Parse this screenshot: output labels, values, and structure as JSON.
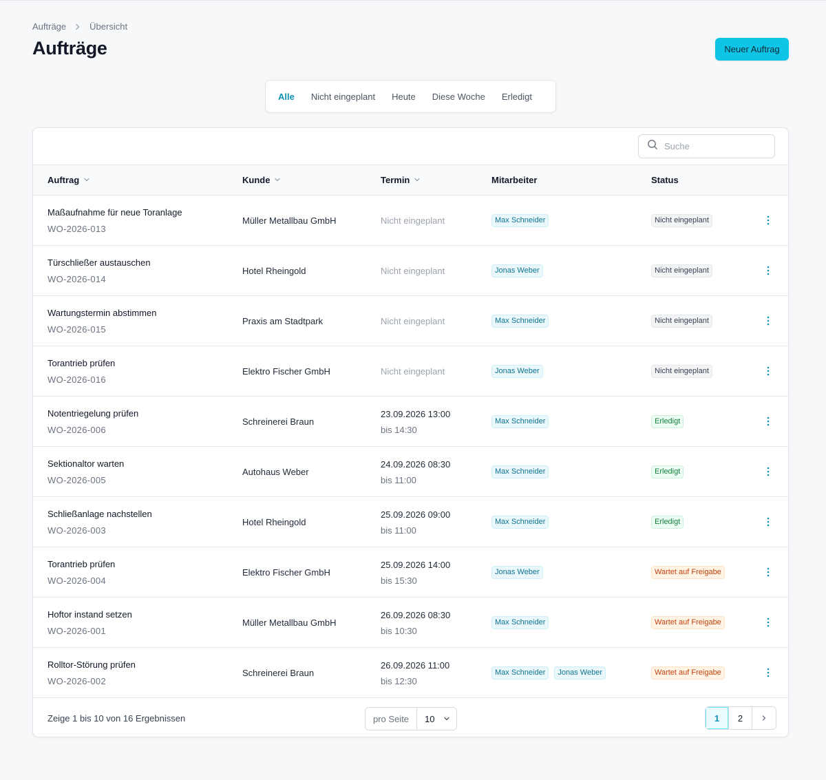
{
  "breadcrumb": {
    "parent": "Aufträge",
    "current": "Übersicht"
  },
  "page_title": "Aufträge",
  "new_order_label": "Neuer Auftrag",
  "tabs": [
    {
      "label": "Alle",
      "active": true
    },
    {
      "label": "Nicht eingeplant"
    },
    {
      "label": "Heute"
    },
    {
      "label": "Diese Woche"
    },
    {
      "label": "Erledigt"
    }
  ],
  "search": {
    "placeholder": "Suche"
  },
  "columns": {
    "order": "Auftrag",
    "customer": "Kunde",
    "term": "Termin",
    "staff": "Mitarbeiter",
    "status": "Status"
  },
  "rows": [
    {
      "title": "Maßaufnahme für neue Toranlage",
      "id": "WO-2026-013",
      "customer": "Müller Metallbau GmbH",
      "term_empty": "Nicht eingeplant",
      "staff": [
        "Max Schneider"
      ],
      "status": "Nicht eingeplant",
      "status_type": "gray"
    },
    {
      "title": "Türschließer austauschen",
      "id": "WO-2026-014",
      "customer": "Hotel Rheingold",
      "term_empty": "Nicht eingeplant",
      "staff": [
        "Jonas Weber"
      ],
      "status": "Nicht eingeplant",
      "status_type": "gray"
    },
    {
      "title": "Wartungstermin abstimmen",
      "id": "WO-2026-015",
      "customer": "Praxis am Stadtpark",
      "term_empty": "Nicht eingeplant",
      "staff": [
        "Max Schneider"
      ],
      "status": "Nicht eingeplant",
      "status_type": "gray"
    },
    {
      "title": "Torantrieb prüfen",
      "id": "WO-2026-016",
      "customer": "Elektro Fischer GmbH",
      "term_empty": "Nicht eingeplant",
      "staff": [
        "Jonas Weber"
      ],
      "status": "Nicht eingeplant",
      "status_type": "gray"
    },
    {
      "title": "Notentriegelung prüfen",
      "id": "WO-2026-006",
      "customer": "Schreinerei Braun",
      "term_date": "23.09.2026 13:00",
      "term_until": "bis 14:30",
      "staff": [
        "Max Schneider"
      ],
      "status": "Erledigt",
      "status_type": "green"
    },
    {
      "title": "Sektionaltor warten",
      "id": "WO-2026-005",
      "customer": "Autohaus Weber",
      "term_date": "24.09.2026 08:30",
      "term_until": "bis 11:00",
      "staff": [
        "Max Schneider"
      ],
      "status": "Erledigt",
      "status_type": "green"
    },
    {
      "title": "Schließanlage nachstellen",
      "id": "WO-2026-003",
      "customer": "Hotel Rheingold",
      "term_date": "25.09.2026 09:00",
      "term_until": "bis 11:00",
      "staff": [
        "Max Schneider"
      ],
      "status": "Erledigt",
      "status_type": "green"
    },
    {
      "title": "Torantrieb prüfen",
      "id": "WO-2026-004",
      "customer": "Elektro Fischer GmbH",
      "term_date": "25.09.2026 14:00",
      "term_until": "bis 15:30",
      "staff": [
        "Jonas Weber"
      ],
      "status": "Wartet auf Freigabe",
      "status_type": "orange"
    },
    {
      "title": "Hoftor instand setzen",
      "id": "WO-2026-001",
      "customer": "Müller Metallbau GmbH",
      "term_date": "26.09.2026 08:30",
      "term_until": "bis 10:30",
      "staff": [
        "Max Schneider"
      ],
      "status": "Wartet auf Freigabe",
      "status_type": "orange"
    },
    {
      "title": "Rolltor-Störung prüfen",
      "id": "WO-2026-002",
      "customer": "Schreinerei Braun",
      "term_date": "26.09.2026 11:00",
      "term_until": "bis 12:30",
      "staff": [
        "Max Schneider",
        "Jonas Weber"
      ],
      "status": "Wartet auf Freigabe",
      "status_type": "orange"
    }
  ],
  "footer": {
    "summary": "Zeige 1 bis 10 von 16 Ergebnissen",
    "per_page_label": "pro Seite",
    "per_page_value": "10",
    "pages": [
      "1",
      "2"
    ],
    "current_page": "1"
  },
  "colors": {
    "accent": "#0ec5e8",
    "accent_text": "#0891b2"
  },
  "icons": {
    "breadcrumb_sep": "chevron-right-icon",
    "sort": "chevron-down-icon",
    "search": "search-icon",
    "row_menu": "kebab-vertical-icon",
    "next": "chevron-right-icon"
  }
}
